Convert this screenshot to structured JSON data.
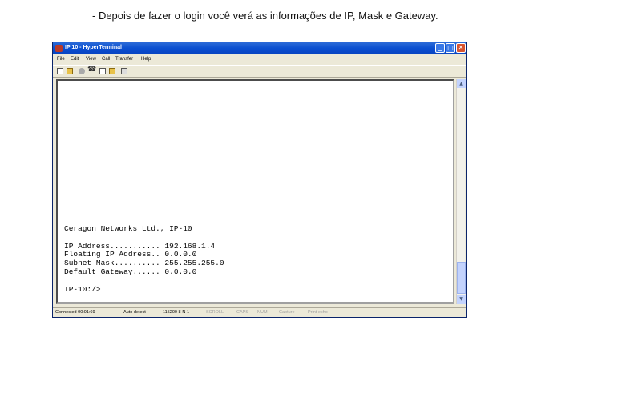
{
  "caption": "- Depois de fazer o login você verá as informações de IP, Mask e Gateway.",
  "window": {
    "title": "IP 10 - HyperTerminal",
    "controls": {
      "minimize": "_",
      "maximize": "□",
      "close": "✕"
    }
  },
  "menu": [
    "File",
    "Edit",
    "View",
    "Call",
    "Transfer",
    "Help"
  ],
  "toolbar_icons": [
    "new-icon",
    "open-icon",
    "disconnect-icon",
    "call-icon",
    "send-icon",
    "receive-icon",
    "properties-icon"
  ],
  "terminal": {
    "lines": [
      "Ceragon Networks Ltd., IP-10",
      "",
      "IP Address........... 192.168.1.4",
      "Floating IP Address.. 0.0.0.0",
      "Subnet Mask.......... 255.255.255.0",
      "Default Gateway...... 0.0.0.0",
      "",
      "IP-10:/>"
    ]
  },
  "scrollbar": {
    "up": "▲",
    "down": "▼"
  },
  "status": {
    "connected": "Connected 00:01:69",
    "detect": "Auto detect",
    "settings": "115200 8-N-1",
    "scroll": "SCROLL",
    "caps": "CAPS",
    "num": "NUM",
    "capture": "Capture",
    "print_echo": "Print echo"
  }
}
